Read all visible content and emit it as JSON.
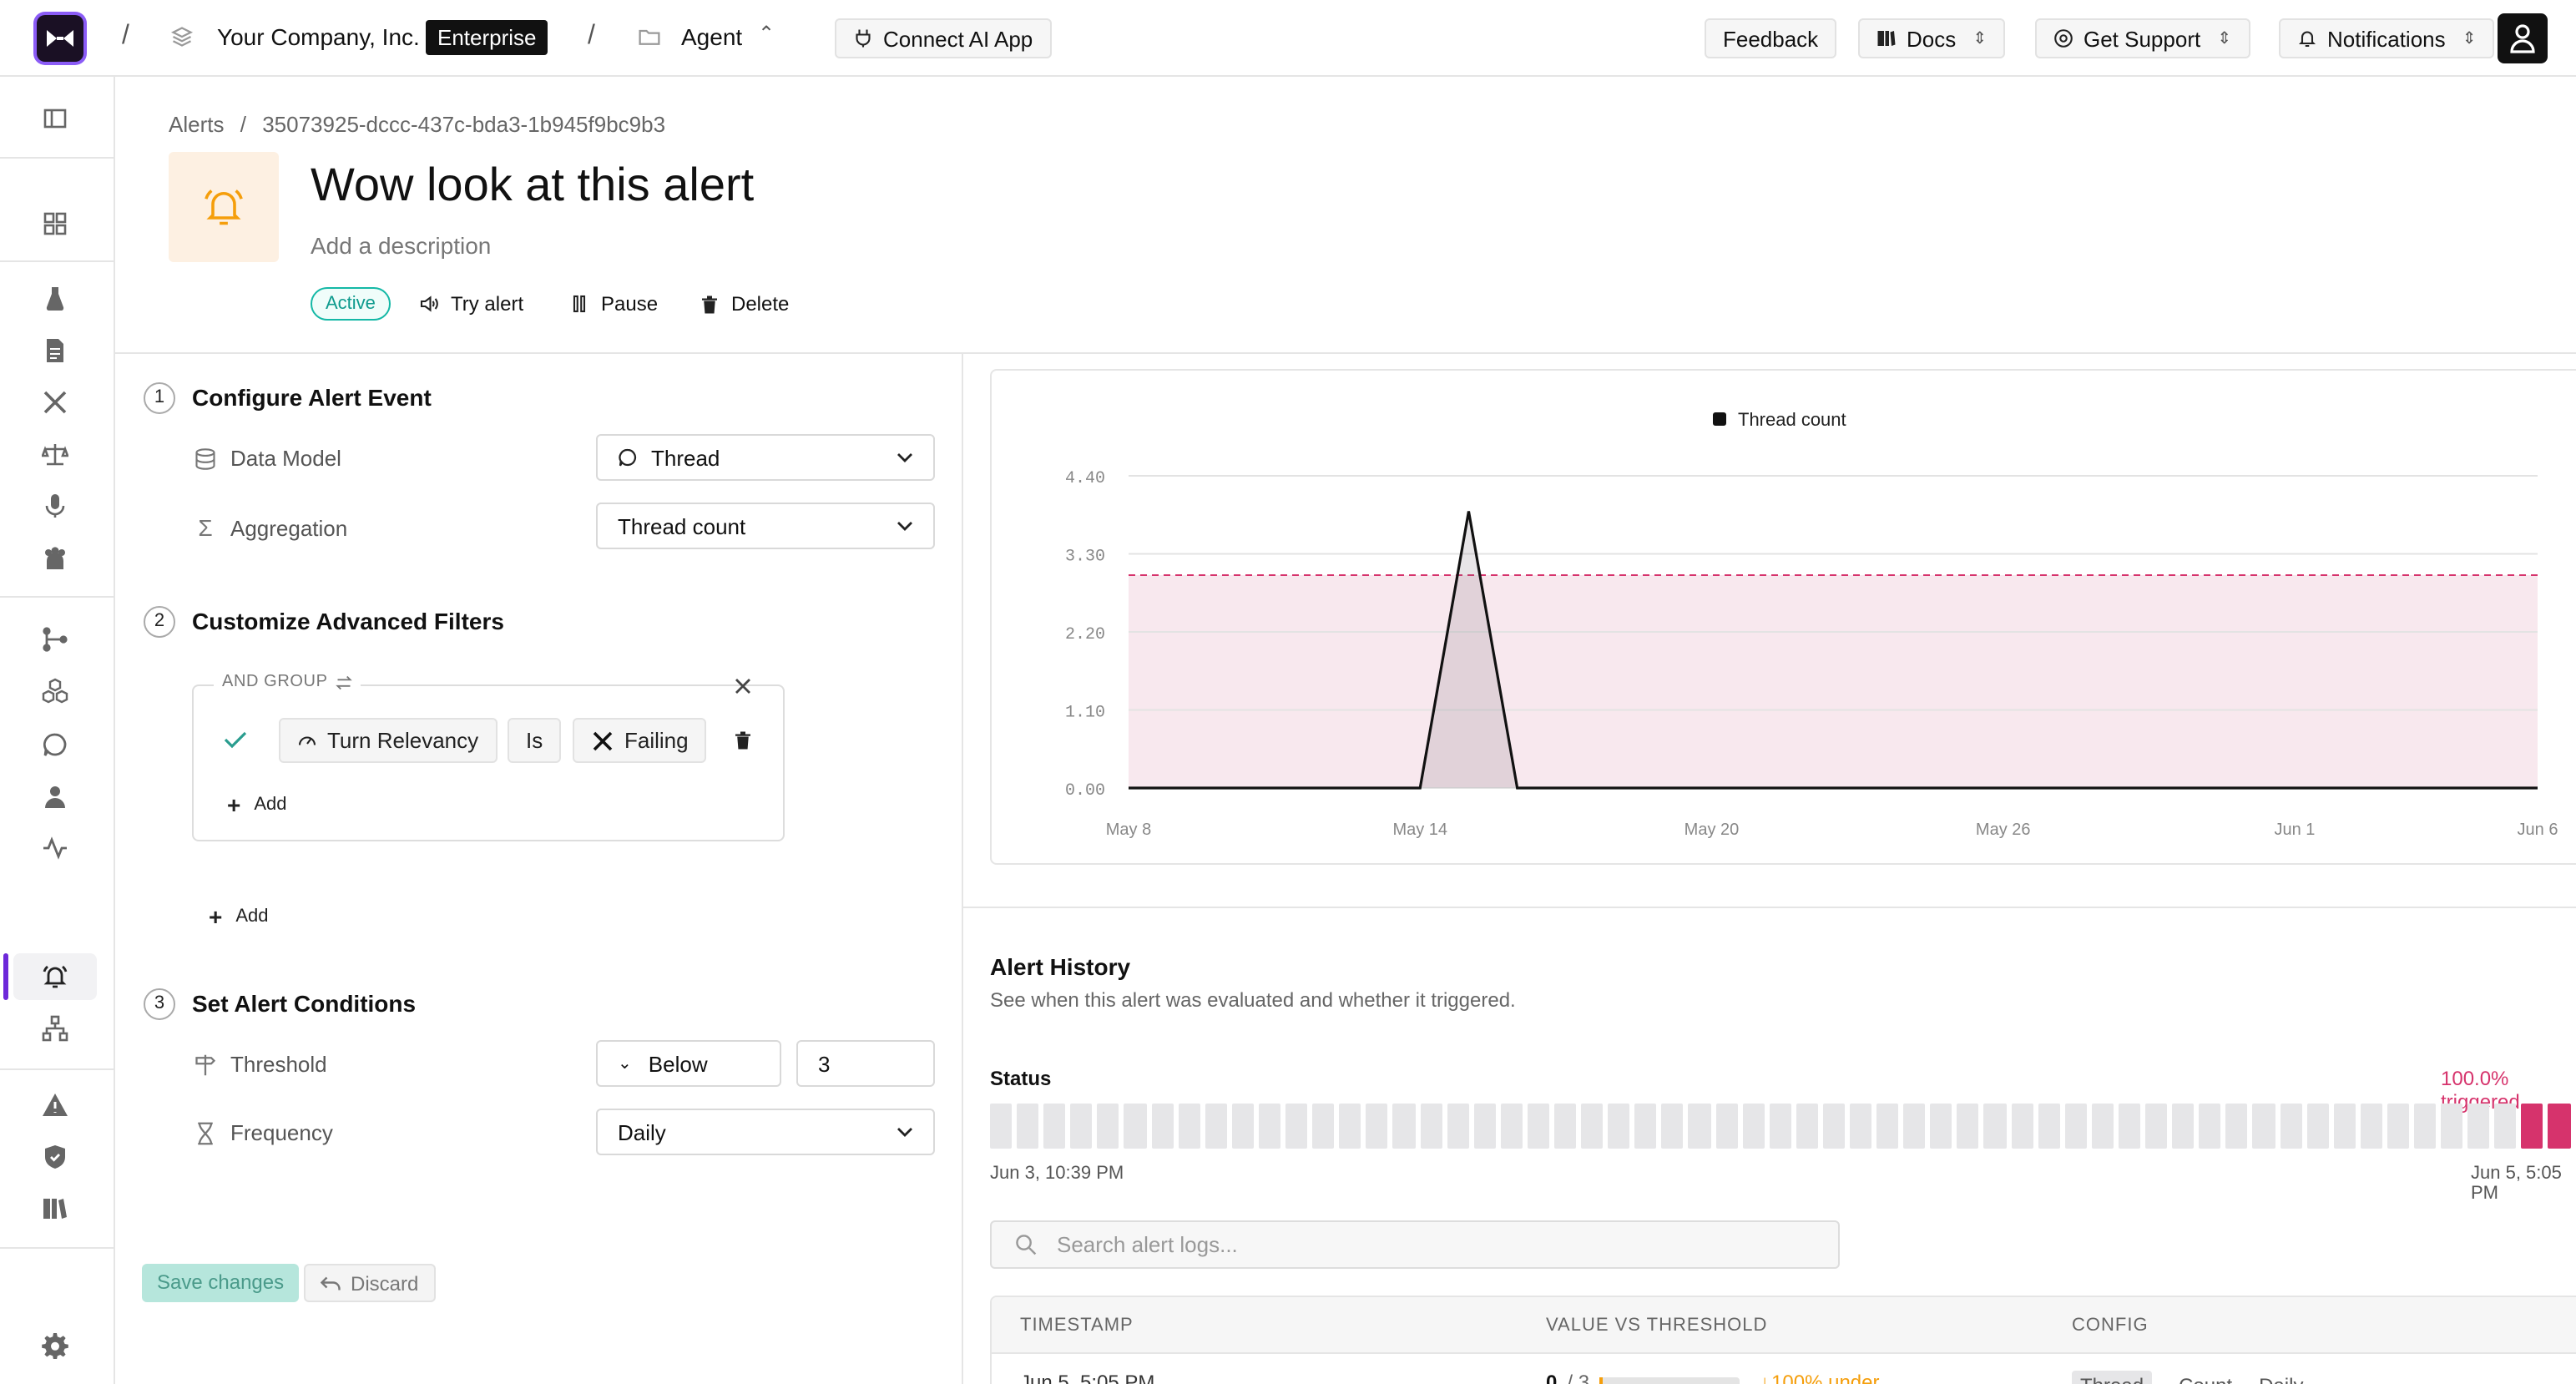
{
  "topbar": {
    "org_name": "Your Company, Inc.",
    "plan_badge": "Enterprise",
    "agent_name": "Agent",
    "connect_label": "Connect AI App",
    "feedback_label": "Feedback",
    "docs_label": "Docs",
    "support_label": "Get Support",
    "notifications_label": "Notifications"
  },
  "breadcrumb": {
    "root": "Alerts",
    "sep": "/",
    "id": "35073925-dccc-437c-bda3-1b945f9bc9b3"
  },
  "alert": {
    "title": "Wow look at this alert",
    "description_placeholder": "Add a description",
    "status": "Active",
    "try_label": "Try alert",
    "pause_label": "Pause",
    "delete_label": "Delete"
  },
  "steps": {
    "s1": {
      "num": "1",
      "title": "Configure Alert Event",
      "data_model_label": "Data Model",
      "data_model_value": "Thread",
      "aggregation_label": "Aggregation",
      "aggregation_value": "Thread count"
    },
    "s2": {
      "num": "2",
      "title": "Customize Advanced Filters",
      "group_label": "AND GROUP",
      "filter_field": "Turn Relevancy",
      "filter_op": "Is",
      "filter_value": "Failing",
      "add_inner": "Add",
      "add_outer": "Add"
    },
    "s3": {
      "num": "3",
      "title": "Set Alert Conditions",
      "threshold_label": "Threshold",
      "threshold_op": "Below",
      "threshold_value": "3",
      "frequency_label": "Frequency",
      "frequency_value": "Daily"
    }
  },
  "actions": {
    "save": "Save changes",
    "discard": "Discard"
  },
  "chart_data": {
    "type": "line",
    "legend": [
      "Thread count"
    ],
    "x": [
      "May 8",
      "May 14",
      "May 20",
      "May 26",
      "Jun 1",
      "Jun 6"
    ],
    "series": [
      {
        "name": "Thread count",
        "points": [
          [
            0,
            0
          ],
          [
            6,
            0
          ],
          [
            7,
            3.9
          ],
          [
            8,
            0
          ],
          [
            29,
            0
          ]
        ]
      }
    ],
    "threshold": 3,
    "ylim": [
      0,
      4.4
    ],
    "yticks": [
      "4.40",
      "3.30",
      "2.20",
      "1.10",
      "0.00"
    ],
    "colors": {
      "line": "#111111",
      "threshold": "#d6336c",
      "band": "#f8e8ee"
    }
  },
  "history": {
    "title": "Alert History",
    "subtitle": "See when this alert was evaluated and whether it triggered.",
    "status_label": "Status",
    "triggered": "100.0% triggered",
    "start": "Jun 3, 10:39 PM",
    "end": "Jun 5, 5:05 PM",
    "bar_count": 60,
    "triggered_bars": 3,
    "search_placeholder": "Search alert logs...",
    "columns": [
      "TIMESTAMP",
      "VALUE VS THRESHOLD",
      "CONFIG"
    ],
    "rows": [
      {
        "timestamp": "Jun 5, 5:05 PM",
        "value": "0",
        "threshold": "/ 3",
        "delta": "100% under",
        "cfg_model": "Thread",
        "cfg_agg": "Count",
        "cfg_freq": "Daily"
      }
    ]
  }
}
